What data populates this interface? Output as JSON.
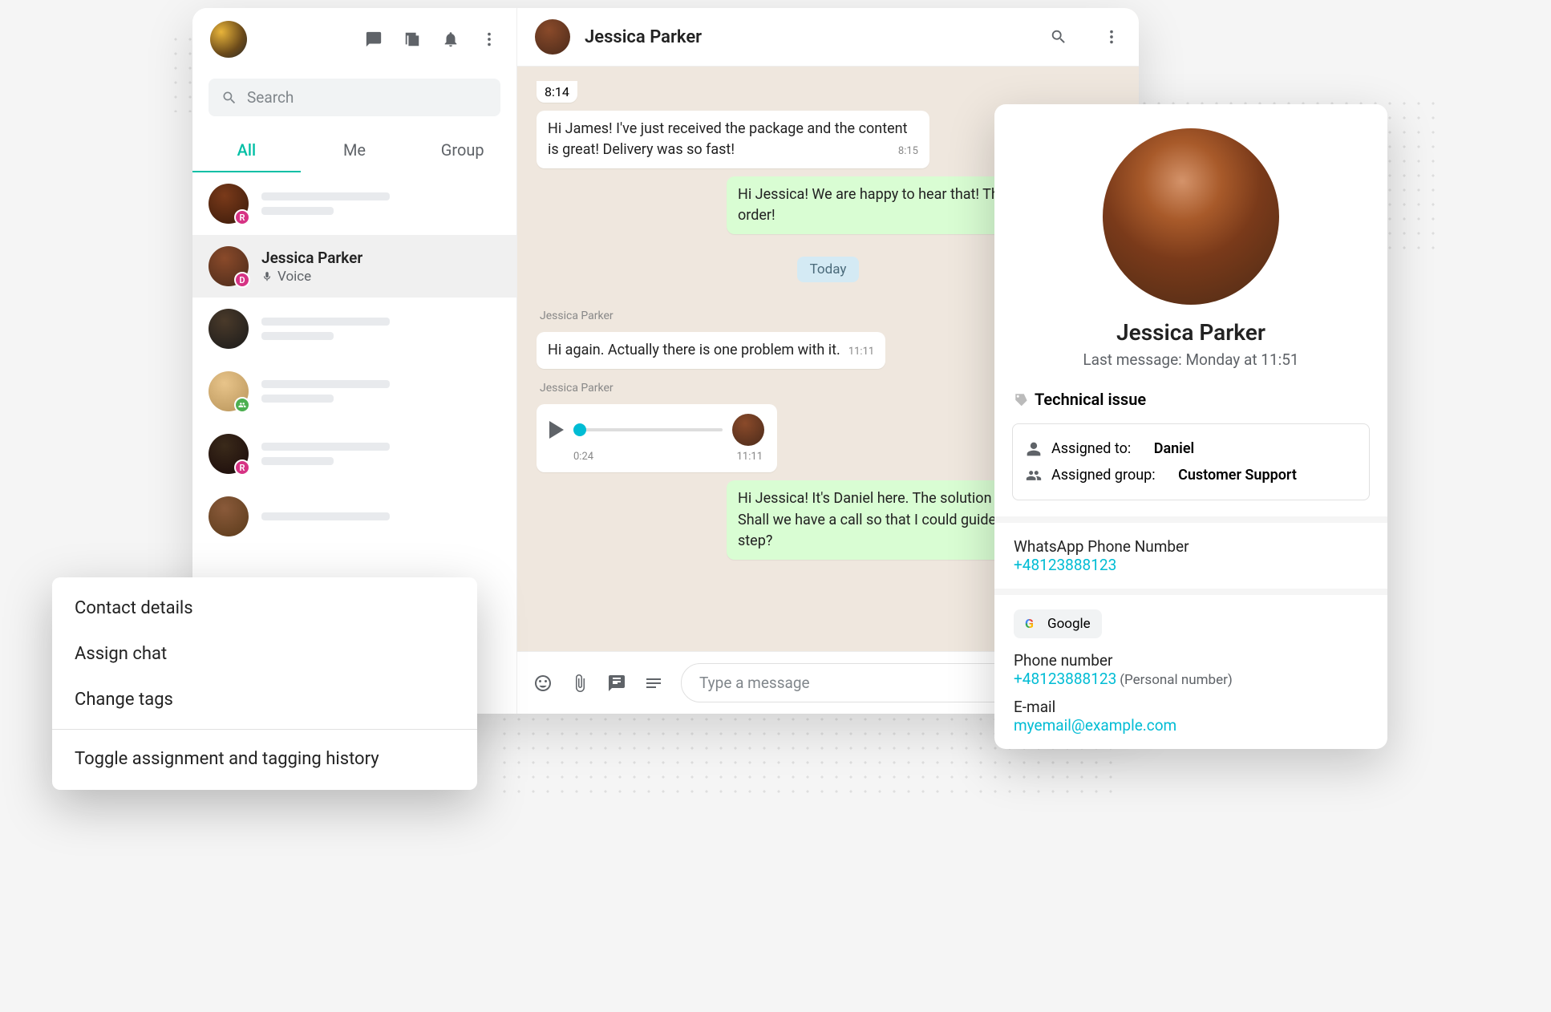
{
  "sidebar": {
    "search_placeholder": "Search",
    "tabs": {
      "all": "All",
      "me": "Me",
      "group": "Group"
    },
    "chats": [
      {
        "name": "",
        "badge": "R"
      },
      {
        "name": "Jessica Parker",
        "sub": "Voice",
        "badge": "D",
        "selected": true
      },
      {
        "name": "",
        "badge": ""
      },
      {
        "name": "",
        "badge": "group"
      },
      {
        "name": "",
        "badge": "R"
      },
      {
        "name": "",
        "badge": ""
      }
    ]
  },
  "conversation": {
    "title": "Jessica Parker",
    "messages": [
      {
        "type": "time_stub",
        "text": "8:14"
      },
      {
        "type": "in",
        "text": "Hi James! I've just received the package and the content is great! Delivery was so fast!",
        "time": "8:15"
      },
      {
        "type": "out",
        "text": "Hi Jessica! We are happy to hear that! Thank you for your order!"
      },
      {
        "type": "date",
        "text": "Today"
      },
      {
        "type": "sender",
        "text": "Jessica Parker"
      },
      {
        "type": "in",
        "text": "Hi again. Actually there is one problem with it.",
        "time": "11:11"
      },
      {
        "type": "sender",
        "text": "Jessica Parker"
      },
      {
        "type": "voice",
        "duration": "0:24",
        "time": "11:11"
      },
      {
        "type": "out",
        "text": "Hi Jessica! It's Daniel here. The solution is quite simple. Shall we have a call so that I could guide you step by step?"
      }
    ],
    "composer_placeholder": "Type a message"
  },
  "context_menu": {
    "items": [
      "Contact details",
      "Assign chat",
      "Change tags"
    ],
    "toggle": "Toggle assignment and tagging history"
  },
  "contact": {
    "name": "Jessica Parker",
    "last_message": "Last message: Monday at 11:51",
    "tag": "Technical issue",
    "assigned_to_label": "Assigned to:",
    "assigned_to": "Daniel",
    "assigned_group_label": "Assigned group:",
    "assigned_group": "Customer Support",
    "whatsapp_label": "WhatsApp Phone Number",
    "whatsapp_number": "+48123888123",
    "google_chip": "Google",
    "phone_label": "Phone number",
    "phone_number": "+48123888123",
    "phone_note": "(Personal number)",
    "email_label": "E-mail",
    "email": "myemail@example.com"
  }
}
